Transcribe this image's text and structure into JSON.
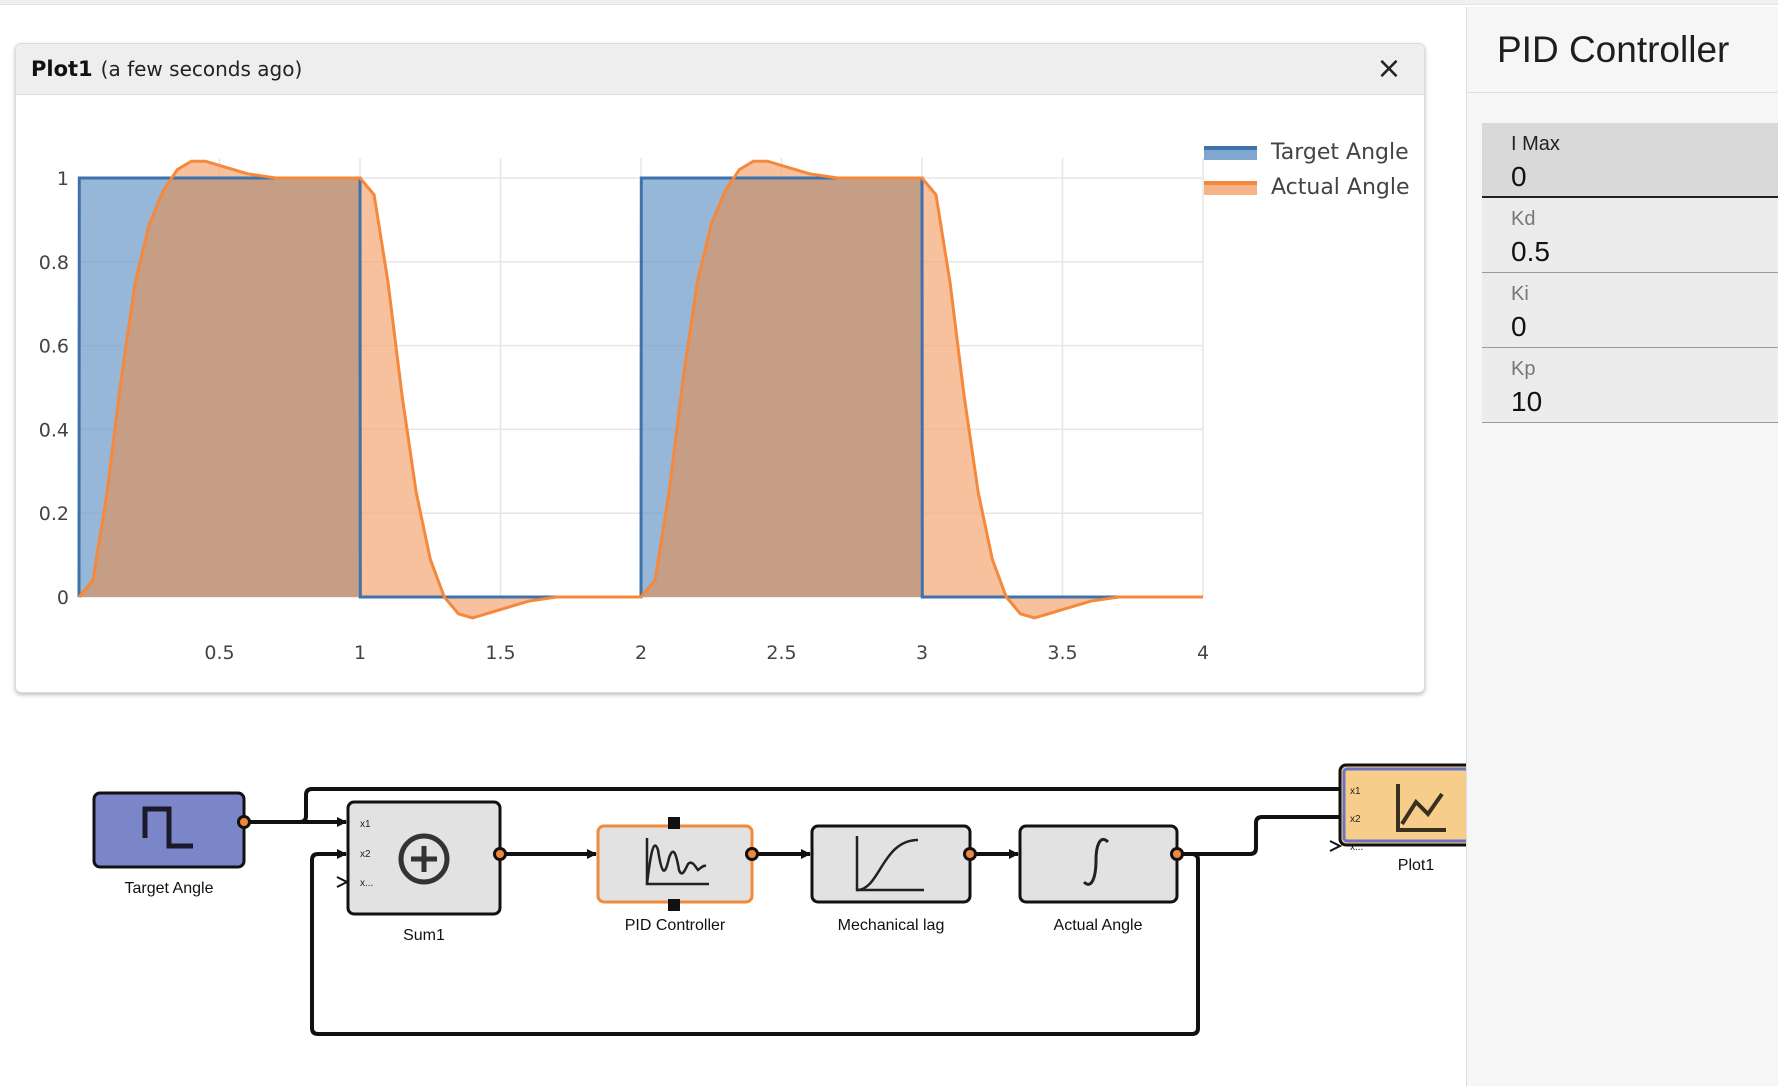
{
  "plot_window": {
    "title": "Plot1",
    "subtitle": "(a few seconds ago)",
    "close_glyph": "×"
  },
  "chart_data": {
    "type": "area",
    "xlim": [
      0,
      4
    ],
    "ylim": [
      0,
      1
    ],
    "x_ticks": [
      "0.5",
      "1",
      "1.5",
      "2",
      "2.5",
      "3",
      "3.5",
      "4"
    ],
    "y_ticks": [
      "0",
      "0.2",
      "0.4",
      "0.6",
      "0.8",
      "1"
    ],
    "grid": true,
    "legend_position": "top-right",
    "series": [
      {
        "name": "Target Angle",
        "color": "#3f72ab",
        "fill": "#6a98c7",
        "x": [
          0,
          0.001,
          1.0,
          1.001,
          2.0,
          2.001,
          3.0,
          3.001,
          4.0
        ],
        "values": [
          0,
          1,
          1,
          0,
          0,
          1,
          1,
          0,
          0
        ]
      },
      {
        "name": "Actual Angle",
        "color": "#f5883a",
        "fill": "#f5a673",
        "x": [
          0,
          0.05,
          0.1,
          0.15,
          0.2,
          0.25,
          0.3,
          0.35,
          0.4,
          0.45,
          0.5,
          0.6,
          0.7,
          0.8,
          0.9,
          1.0,
          1.05,
          1.1,
          1.15,
          1.2,
          1.25,
          1.3,
          1.35,
          1.4,
          1.45,
          1.5,
          1.6,
          1.7,
          1.8,
          2.0,
          2.05,
          2.1,
          2.15,
          2.2,
          2.25,
          2.3,
          2.35,
          2.4,
          2.45,
          2.5,
          2.6,
          2.7,
          2.8,
          2.9,
          3.0,
          3.05,
          3.1,
          3.15,
          3.2,
          3.25,
          3.3,
          3.35,
          3.4,
          3.45,
          3.5,
          3.6,
          3.7,
          3.8,
          4.0
        ],
        "values": [
          0,
          0.04,
          0.25,
          0.52,
          0.75,
          0.89,
          0.97,
          1.02,
          1.04,
          1.04,
          1.03,
          1.01,
          1.0,
          1.0,
          1.0,
          1.0,
          0.96,
          0.75,
          0.48,
          0.25,
          0.09,
          0.0,
          -0.04,
          -0.05,
          -0.04,
          -0.03,
          -0.01,
          0.0,
          0.0,
          0.0,
          0.04,
          0.25,
          0.52,
          0.75,
          0.89,
          0.97,
          1.02,
          1.04,
          1.04,
          1.03,
          1.01,
          1.0,
          1.0,
          1.0,
          1.0,
          0.96,
          0.75,
          0.48,
          0.25,
          0.09,
          0.0,
          -0.04,
          -0.05,
          -0.04,
          -0.03,
          -0.01,
          0.0,
          0.0,
          0.0
        ]
      }
    ],
    "overlap_fill": "#c69e85"
  },
  "side_panel": {
    "title": "PID Controller",
    "params": [
      {
        "label": "I Max",
        "value": "0"
      },
      {
        "label": "Kd",
        "value": "0.5"
      },
      {
        "label": "Ki",
        "value": "0"
      },
      {
        "label": "Kp",
        "value": "10"
      }
    ]
  },
  "diagram": {
    "blocks": {
      "target_angle": {
        "label": "Target Angle",
        "icon": "square-wave-icon",
        "color": "#7b86c8"
      },
      "sum1": {
        "label": "Sum1",
        "icon": "plus-circle-icon",
        "ports": [
          "x1",
          "x2",
          "x..."
        ]
      },
      "pid": {
        "label": "PID Controller",
        "icon": "pid-response-icon",
        "border_color": "#f08a3c"
      },
      "mech_lag": {
        "label": "Mechanical lag",
        "icon": "s-curve-icon"
      },
      "actual_angle": {
        "label": "Actual Angle",
        "icon": "integral-icon"
      },
      "plot1": {
        "label": "Plot1",
        "icon": "line-chart-icon",
        "color": "#f7cd8b",
        "ports": [
          "x1",
          "x2",
          "x..."
        ]
      }
    }
  }
}
